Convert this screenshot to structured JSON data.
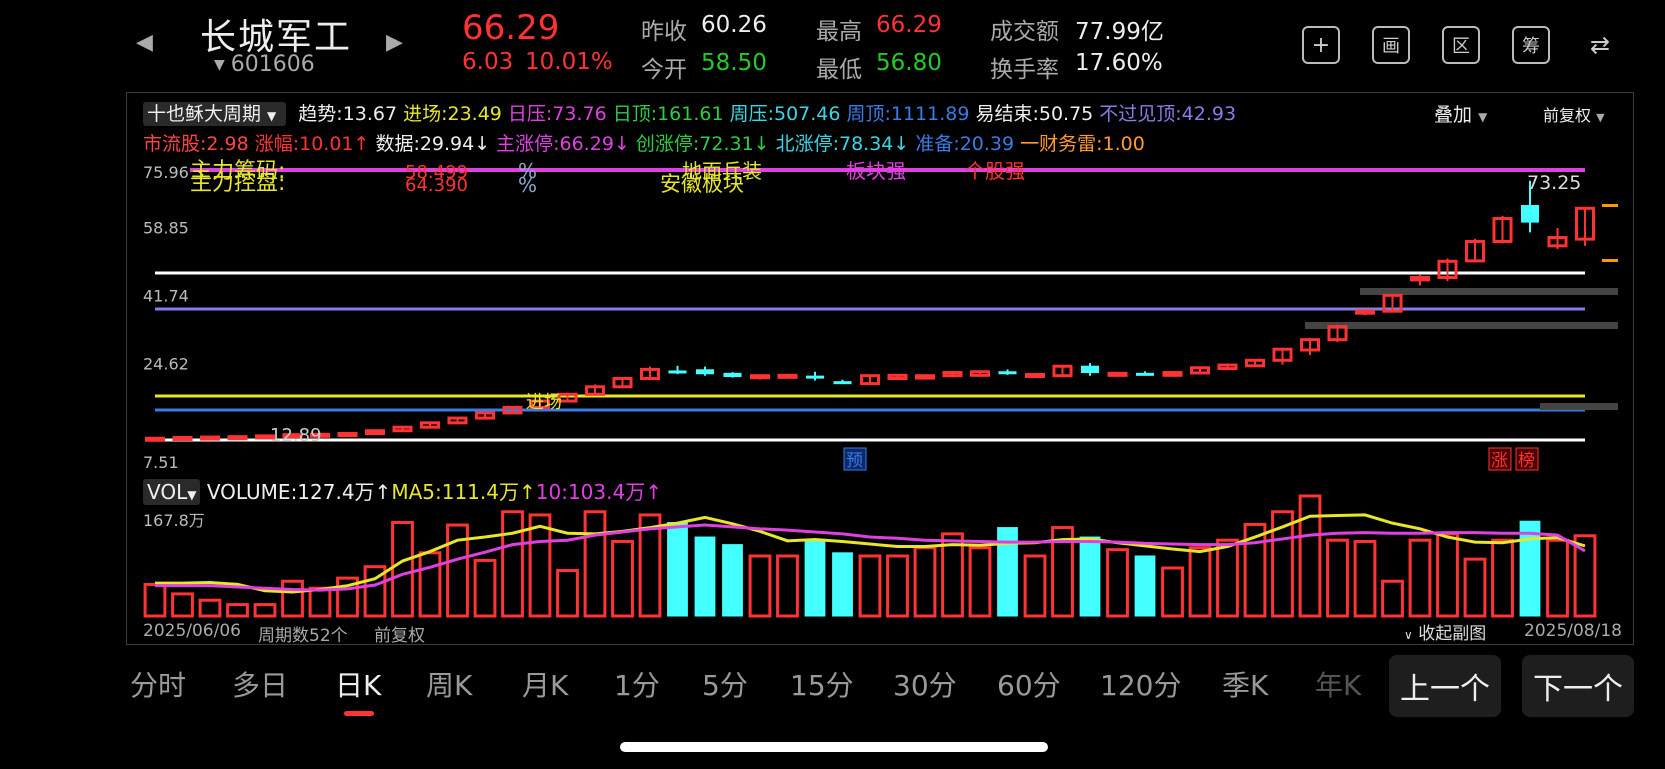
{
  "header": {
    "prev_arrow": "◀",
    "next_arrow": "▶",
    "name": "长城军工",
    "code": "601606",
    "price": "66.29",
    "change": "6.03",
    "change_pct": "10.01%",
    "prev_close_label": "昨收",
    "prev_close": "60.26",
    "open_label": "今开",
    "open": "58.50",
    "high_label": "最高",
    "high": "66.29",
    "low_label": "最低",
    "low": "56.80",
    "amount_label": "成交额",
    "amount": "77.99亿",
    "turnover_label": "换手率",
    "turnover": "17.60%"
  },
  "toolbar": {
    "add_glyph": "+",
    "draw_glyph": "画",
    "range_glyph": "区",
    "chip_glyph": "筹",
    "switch_glyph": "⇄"
  },
  "indicator": {
    "name": "十也稣大周期",
    "items_row1": [
      {
        "text": "趋势:13.67",
        "color": "#eeeeee"
      },
      {
        "text": "进场:23.49",
        "color": "#e6e62a"
      },
      {
        "text": "日压:73.76",
        "color": "#e040e0"
      },
      {
        "text": "日顶:161.61",
        "color": "#2ecc40"
      },
      {
        "text": "周压:507.46",
        "color": "#3ad6e6"
      },
      {
        "text": "周顶:1111.89",
        "color": "#3a7ce6"
      },
      {
        "text": "易结束:50.75",
        "color": "#eeeeee"
      },
      {
        "text": "不过见顶:42.93",
        "color": "#8a7ce6"
      }
    ],
    "items_row2": [
      {
        "text": "市流股:2.98",
        "color": "#ff4444"
      },
      {
        "text": "涨幅:10.01↑",
        "color": "#ff3333"
      },
      {
        "text": "数据:29.94↓",
        "color": "#eeeeee"
      },
      {
        "text": "主涨停:66.29↓",
        "color": "#e040e0"
      },
      {
        "text": "创涨停:72.31↓",
        "color": "#2ecc40"
      },
      {
        "text": "北涨停:78.34↓",
        "color": "#3ad6e6"
      },
      {
        "text": "准备:20.39",
        "color": "#3a7ce6"
      },
      {
        "text": "一财务雷:1.00",
        "color": "#ff9933"
      }
    ],
    "overlay_label": "叠加",
    "adjust_label": "前复权"
  },
  "annotations": {
    "a1": "主力筹码:",
    "a2": "主力控盘:",
    "a3": "58.499",
    "a4": "64.390",
    "a5": "%",
    "a6": "%",
    "a7": "地面兵装",
    "a8": "安徽板块",
    "a9": "板块强",
    "a10": "个股强",
    "high_label": "73.25",
    "low_label": "12.89",
    "entry_label": "进场",
    "pre_tag": "预",
    "tag1": "涨",
    "tag2": "榜"
  },
  "chart_data": {
    "type": "candlestick",
    "price_axis_ticks": [
      "75.96",
      "58.85",
      "41.74",
      "24.62",
      "7.51"
    ],
    "ylim": [
      7.51,
      75.96
    ],
    "ohlc": [
      [
        8.0,
        8.3,
        7.9,
        8.2
      ],
      [
        8.2,
        8.5,
        8.1,
        8.4
      ],
      [
        8.4,
        8.6,
        8.3,
        8.5
      ],
      [
        8.5,
        8.7,
        8.4,
        8.6
      ],
      [
        8.6,
        8.9,
        8.5,
        8.8
      ],
      [
        8.8,
        9.2,
        8.7,
        9.1
      ],
      [
        9.1,
        9.3,
        9.0,
        9.2
      ],
      [
        9.2,
        9.5,
        9.1,
        9.4
      ],
      [
        9.4,
        10.2,
        9.3,
        10.1
      ],
      [
        10.1,
        11.0,
        10.0,
        11.0
      ],
      [
        11.0,
        12.2,
        10.9,
        12.1
      ],
      [
        12.1,
        13.4,
        12.0,
        13.3
      ],
      [
        13.3,
        14.6,
        13.2,
        14.6
      ],
      [
        14.6,
        16.1,
        14.2,
        16.0
      ],
      [
        16.0,
        18.2,
        15.8,
        17.6
      ],
      [
        17.6,
        19.7,
        17.4,
        19.3
      ],
      [
        19.3,
        21.8,
        19.2,
        21.2
      ],
      [
        21.2,
        23.3,
        21.0,
        23.3
      ],
      [
        23.3,
        26.3,
        23.1,
        25.6
      ],
      [
        25.2,
        26.5,
        24.4,
        25.0
      ],
      [
        25.5,
        26.3,
        24.0,
        24.5
      ],
      [
        24.6,
        24.9,
        23.5,
        23.8
      ],
      [
        23.8,
        24.4,
        23.0,
        24.0
      ],
      [
        23.9,
        24.5,
        23.5,
        24.1
      ],
      [
        23.9,
        25.0,
        22.8,
        23.8
      ],
      [
        22.5,
        23.0,
        22.0,
        22.4
      ],
      [
        22.0,
        24.3,
        21.8,
        24.0
      ],
      [
        23.3,
        24.4,
        23.0,
        24.1
      ],
      [
        23.4,
        24.2,
        23.0,
        24.0
      ],
      [
        24.0,
        25.2,
        23.6,
        24.8
      ],
      [
        24.1,
        25.2,
        23.8,
        25.0
      ],
      [
        25.0,
        25.6,
        24.2,
        24.6
      ],
      [
        23.8,
        24.5,
        23.4,
        24.3
      ],
      [
        24.0,
        26.5,
        23.8,
        26.4
      ],
      [
        26.4,
        27.2,
        24.0,
        24.8
      ],
      [
        24.6,
        25.0,
        24.2,
        24.6
      ],
      [
        24.6,
        25.1,
        24.1,
        24.4
      ],
      [
        24.1,
        25.0,
        23.8,
        24.8
      ],
      [
        24.7,
        26.1,
        24.5,
        26.0
      ],
      [
        25.8,
        27.0,
        25.4,
        26.7
      ],
      [
        26.5,
        28.1,
        26.2,
        27.9
      ],
      [
        27.9,
        30.7,
        26.8,
        30.7
      ],
      [
        30.5,
        33.5,
        29.2,
        33.1
      ],
      [
        33.1,
        36.9,
        32.5,
        36.4
      ],
      [
        40.0,
        40.5,
        39.3,
        40.3
      ],
      [
        40.3,
        44.5,
        40.2,
        44.3
      ],
      [
        48.2,
        49.5,
        46.8,
        48.8
      ],
      [
        48.8,
        53.6,
        47.9,
        52.9
      ],
      [
        53.0,
        58.6,
        52.7,
        57.9
      ],
      [
        57.9,
        64.4,
        57.4,
        63.7
      ],
      [
        67.0,
        73.25,
        60.2,
        62.8
      ],
      [
        56.8,
        61.3,
        56.0,
        58.9
      ],
      [
        58.5,
        66.29,
        56.8,
        66.29
      ]
    ],
    "volume": {
      "label": "VOL",
      "readout": [
        {
          "text": "VOLUME:127.4万↑",
          "color": "#eeeeee"
        },
        {
          "text": "MA5:111.4万↑",
          "color": "#e6e62a"
        },
        {
          "text": "10:103.4万↑",
          "color": "#e040e0"
        }
      ],
      "max_label": "167.8万",
      "ylim": [
        0,
        167.8
      ],
      "values": [
        50,
        35,
        25,
        18,
        18,
        55,
        44,
        60,
        78,
        148,
        100,
        144,
        88,
        165,
        160,
        72,
        165,
        118,
        160,
        148,
        125,
        113,
        95,
        95,
        118,
        100,
        95,
        95,
        108,
        130,
        108,
        140,
        95,
        140,
        125,
        105,
        95,
        76,
        108,
        120,
        145,
        165,
        190,
        120,
        118,
        55,
        120,
        130,
        90,
        120,
        150,
        120,
        127
      ],
      "ma5": [
        52,
        52,
        53,
        50,
        40,
        38,
        42,
        48,
        59,
        87,
        102,
        120,
        125,
        131,
        142,
        131,
        130,
        134,
        140,
        147,
        156,
        146,
        134,
        119,
        121,
        118,
        114,
        110,
        110,
        113,
        112,
        115,
        116,
        121,
        122,
        116,
        111,
        106,
        102,
        110,
        125,
        141,
        158,
        159,
        160,
        147,
        138,
        125,
        117,
        116,
        122,
        124,
        111
      ],
      "ma10": [
        48,
        48,
        48,
        46,
        44,
        42,
        41,
        43,
        49,
        66,
        77,
        90,
        101,
        113,
        118,
        120,
        128,
        133,
        138,
        141,
        144,
        141,
        138,
        136,
        133,
        130,
        125,
        123,
        120,
        119,
        118,
        117,
        117,
        118,
        118,
        117,
        115,
        114,
        113,
        113,
        116,
        122,
        128,
        131,
        132,
        131,
        131,
        132,
        132,
        131,
        131,
        128,
        103
      ]
    }
  },
  "footer": {
    "start_date": "2025/06/06",
    "period_count": "周期数52个",
    "adjust": "前复权",
    "collapse": "收起副图",
    "end_date": "2025/08/18"
  },
  "tabs": [
    "分时",
    "多日",
    "日K",
    "周K",
    "月K",
    "1分",
    "5分",
    "15分",
    "30分",
    "60分",
    "120分",
    "季K",
    "年K"
  ],
  "active_tab": "日K",
  "nav": {
    "prev": "上一个",
    "next": "下一个"
  }
}
